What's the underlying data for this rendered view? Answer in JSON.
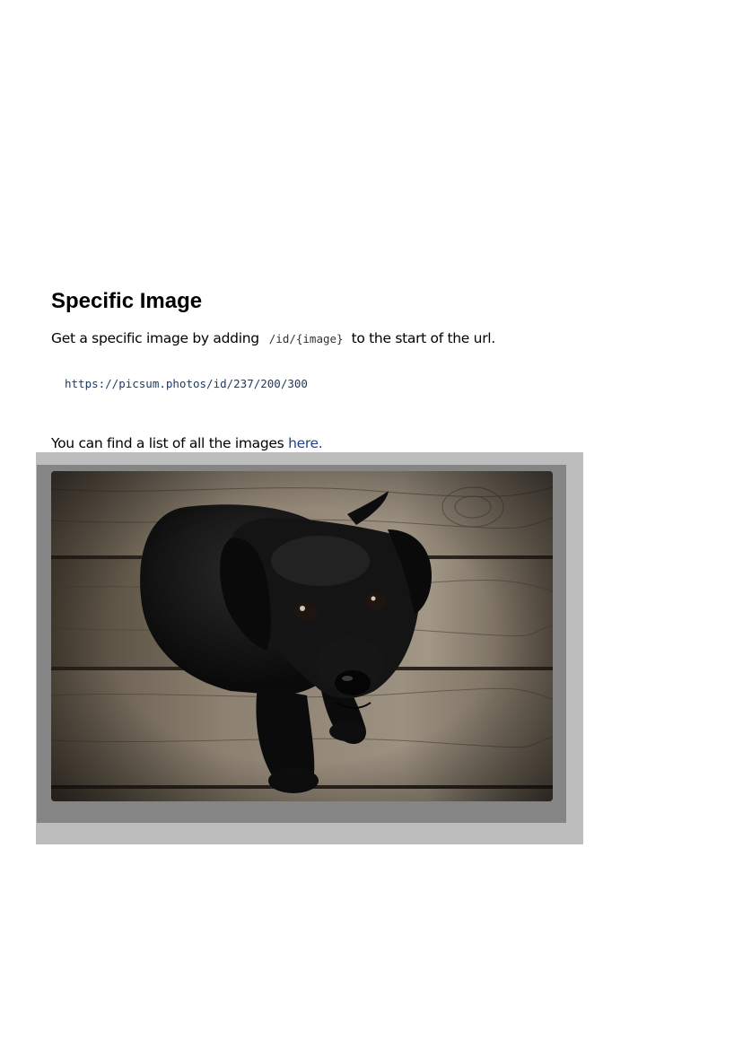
{
  "section": {
    "title": "Specific Image",
    "intro_before": "Get a specific image by adding",
    "intro_code": "/id/{image}",
    "intro_after": "to the start of the url.",
    "example_url": "https://picsum.photos/id/237/200/300",
    "list_text": "You can find a list of all the images",
    "list_link": "here."
  },
  "image": {
    "subject": "black-labrador-puppy-on-wooden-deck"
  },
  "colors": {
    "link": "#1f3f8f",
    "code_url": "#1f3a66",
    "frame_outer": "#bdbdbd",
    "frame_inner": "#858585"
  }
}
